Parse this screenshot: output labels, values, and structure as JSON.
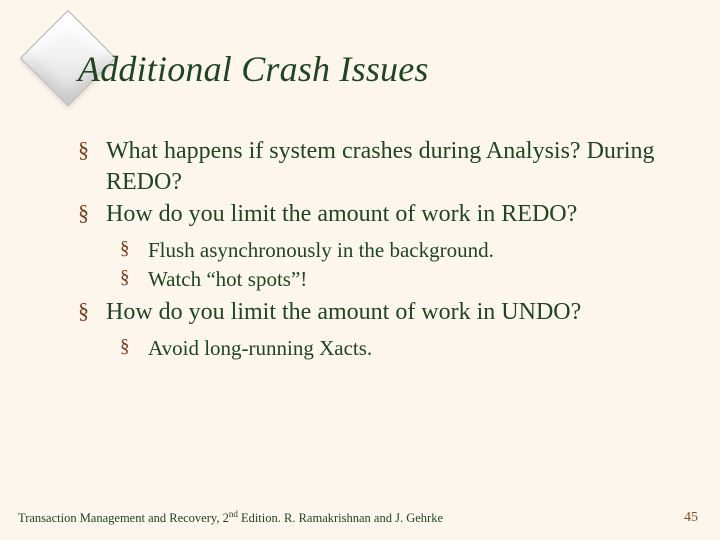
{
  "title": "Additional Crash Issues",
  "bullets": {
    "b1": "What happens if system crashes during Analysis? During ",
    "b1_redo": "REDO",
    "b1_tail": "?",
    "b2": "How do you limit the amount of work in ",
    "b2_redo": "REDO",
    "b2_tail": "?",
    "b2_sub1": "Flush asynchronously in the background.",
    "b2_sub2": "Watch “hot spots”!",
    "b3": "How do you limit the amount of work in ",
    "b3_undo": "UNDO",
    "b3_tail": "?",
    "b3_sub1": "Avoid long-running Xacts."
  },
  "footer": {
    "pre": "Transaction Management and Recovery, 2",
    "sup": "nd",
    "post": " Edition. R. Ramakrishnan and J. Gehrke"
  },
  "page_number": "45"
}
